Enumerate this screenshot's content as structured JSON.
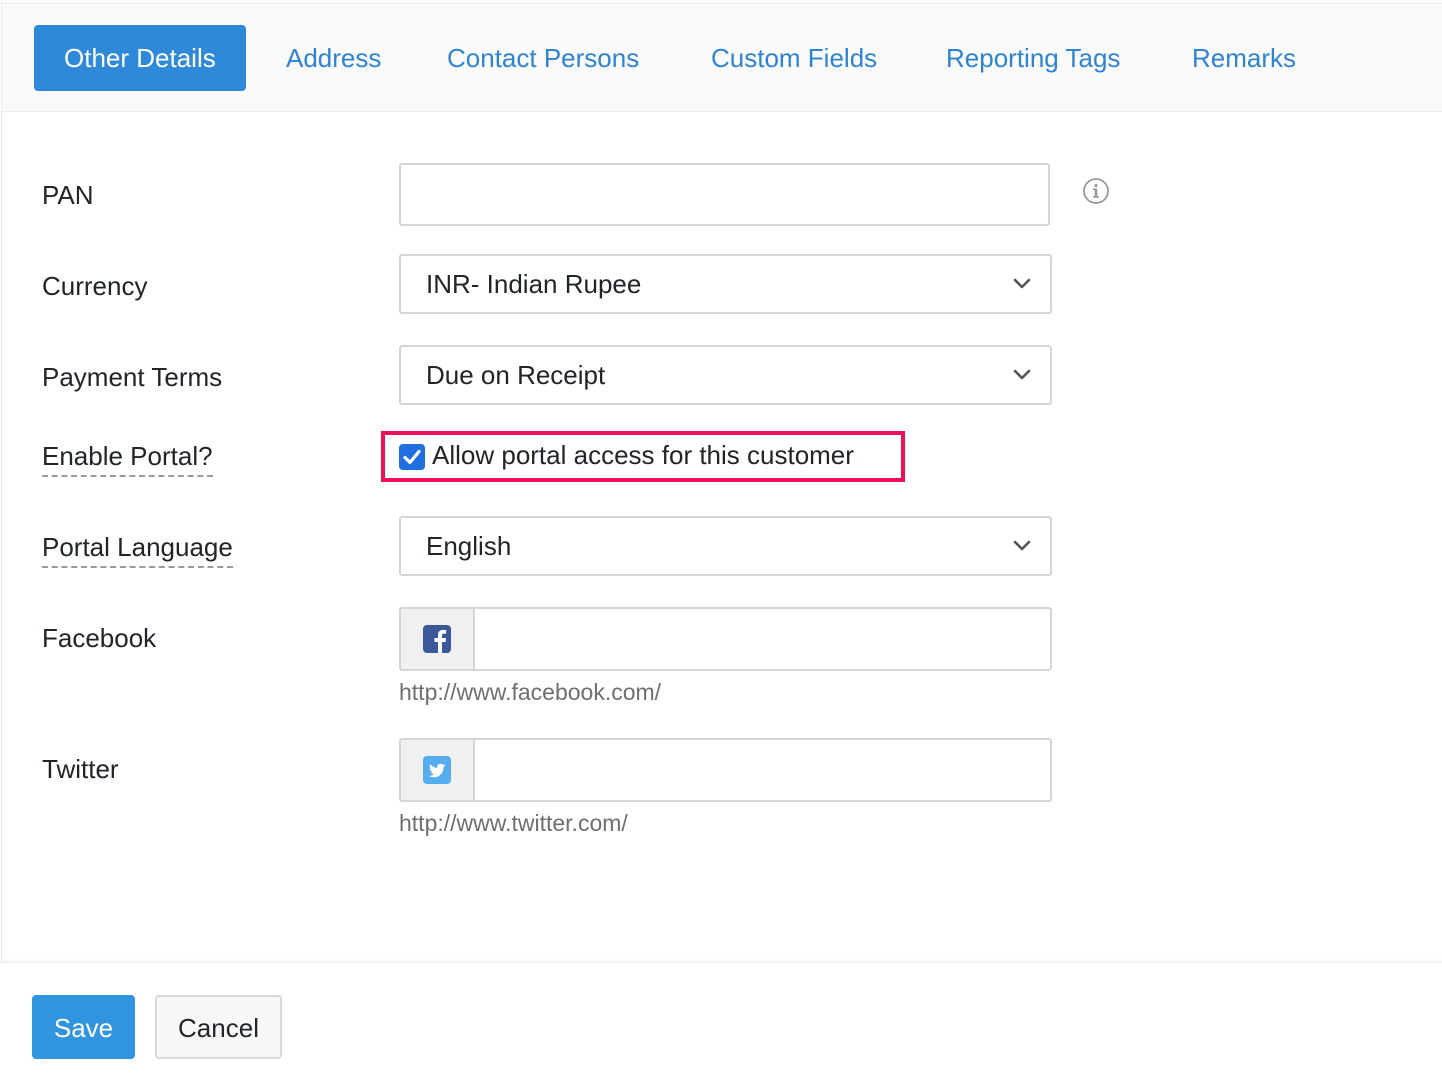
{
  "tabs": [
    {
      "label": "Other Details",
      "active": true
    },
    {
      "label": "Address"
    },
    {
      "label": "Contact Persons"
    },
    {
      "label": "Custom Fields"
    },
    {
      "label": "Reporting Tags"
    },
    {
      "label": "Remarks"
    }
  ],
  "form": {
    "pan": {
      "label": "PAN",
      "value": ""
    },
    "currency": {
      "label": "Currency",
      "value": "INR- Indian Rupee"
    },
    "payment_terms": {
      "label": "Payment Terms",
      "value": "Due on Receipt"
    },
    "enable_portal": {
      "label": "Enable Portal?",
      "checkbox_label": "Allow portal access for this customer",
      "checked": true
    },
    "portal_language": {
      "label": "Portal Language",
      "value": "English"
    },
    "facebook": {
      "label": "Facebook",
      "value": "",
      "hint": "http://www.facebook.com/"
    },
    "twitter": {
      "label": "Twitter",
      "value": "",
      "hint": "http://www.twitter.com/"
    }
  },
  "footer": {
    "save_label": "Save",
    "cancel_label": "Cancel"
  },
  "colors": {
    "accent": "#2e8ad8",
    "link": "#2e83d5",
    "highlight": "#ef0f58",
    "facebook": "#3b5998",
    "twitter": "#55acee"
  },
  "icons": {
    "info": "info-icon",
    "chevron": "chevron-down-icon",
    "facebook": "facebook-icon",
    "twitter": "twitter-icon",
    "check": "check-icon"
  }
}
